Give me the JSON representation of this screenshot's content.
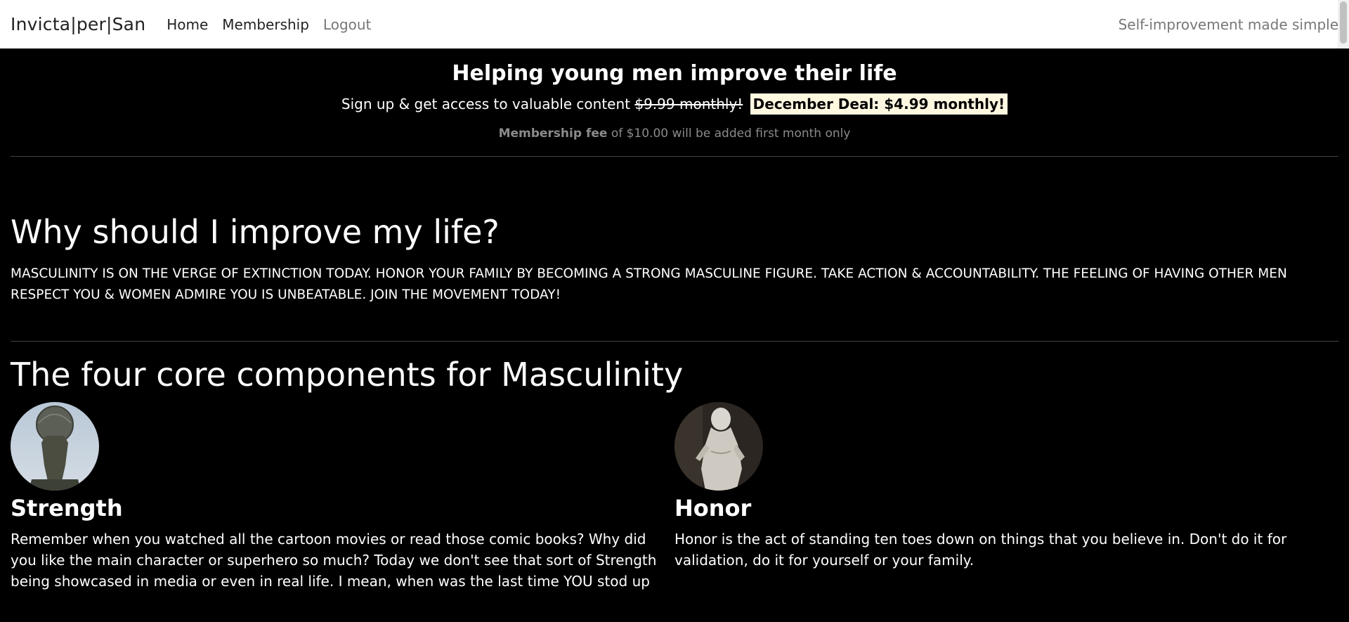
{
  "nav": {
    "brand": "Invicta|per|San",
    "links": [
      "Home",
      "Membership",
      "Logout"
    ],
    "tagline": "Self-improvement made simple"
  },
  "hero": {
    "title": "Helping young men improve their life",
    "signup_text": "Sign up & get access to valuable content",
    "old_price": "$9.99 monthly!",
    "deal": "December Deal: $4.99 monthly!",
    "fee_bold": "Membership fee",
    "fee_rest": "of $10.00 will be added first month only"
  },
  "why": {
    "title": "Why should I improve my life?",
    "body": "MASCULINITY IS ON THE VERGE OF EXTINCTION TODAY. HONOR YOUR FAMILY BY BECOMING A STRONG MASCULINE FIGURE. TAKE ACTION & ACCOUNTABILITY. THE FEELING OF HAVING OTHER MEN RESPECT YOU & WOMEN ADMIRE YOU IS UNBEATABLE. JOIN THE MOVEMENT TODAY!"
  },
  "core": {
    "title": "The four core components for Masculinity",
    "cards": [
      {
        "title": "Strength",
        "text": "Remember when you watched all the cartoon movies or read those comic books? Why did you like the main character or superhero so much? Today we don't see that sort of Strength being showcased in media or even in real life. I mean, when was the last time YOU stod up",
        "icon": "atlas-statue-image"
      },
      {
        "title": "Honor",
        "text": "Honor is the act of standing ten toes down on things that you believe in. Don't do it for validation, do it for yourself or your family.",
        "icon": "hercules-statue-image"
      }
    ]
  }
}
